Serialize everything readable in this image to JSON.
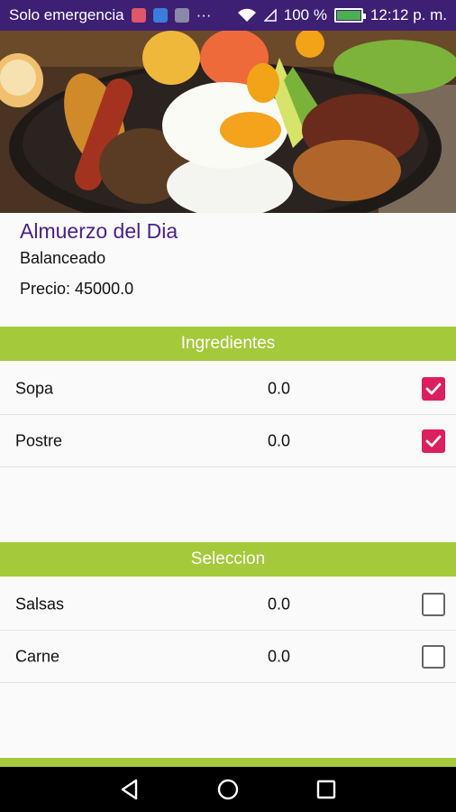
{
  "status_bar": {
    "carrier": "Solo emergencia",
    "battery_text": "100 %",
    "time": "12:12 p. m.",
    "icons": [
      "notification-red-icon",
      "notification-blue-icon",
      "gallery-icon",
      "more-dots-icon",
      "wifi-icon",
      "signal-icon",
      "battery-icon"
    ]
  },
  "dish": {
    "name": "Almuerzo del Dia",
    "type": "Balanceado",
    "price": "Precio: 45000.0"
  },
  "ingredientes": {
    "title": "Ingredientes",
    "items": [
      {
        "label": "Sopa",
        "value": "0.0",
        "checked": true
      },
      {
        "label": "Postre",
        "value": "0.0",
        "checked": true
      }
    ]
  },
  "seleccion": {
    "title": "Seleccion",
    "items": [
      {
        "label": "Salsas",
        "value": "0.0",
        "checked": false
      },
      {
        "label": "Carne",
        "value": "0.0",
        "checked": false
      }
    ]
  },
  "colors": {
    "status_bar": "#3d1f74",
    "accent_green": "#a4c93a",
    "title_purple": "#4a1f8c",
    "checkbox_pink": "#dc1f5e"
  },
  "nav": {
    "buttons": [
      "back-icon",
      "home-icon",
      "recents-icon"
    ]
  }
}
